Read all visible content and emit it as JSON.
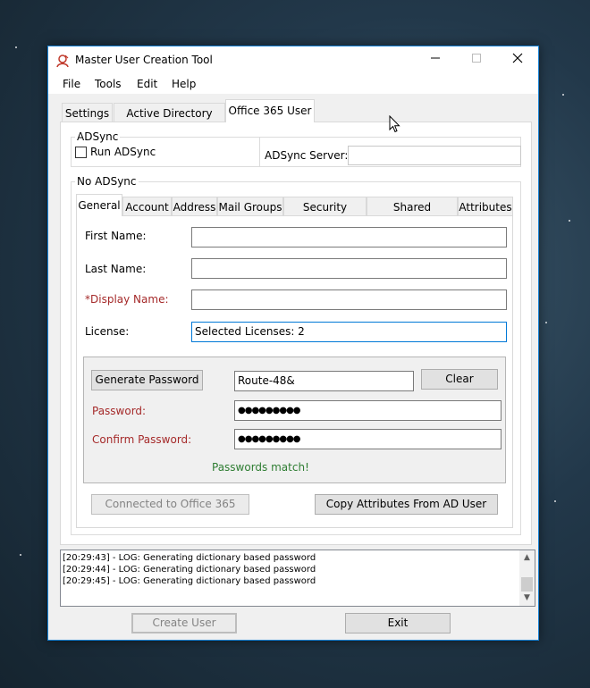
{
  "window": {
    "title": "Master User Creation Tool"
  },
  "menu": [
    "File",
    "Tools",
    "Edit",
    "Help"
  ],
  "main_tabs": [
    "Settings",
    "Active Directory User",
    "Office 365 User"
  ],
  "adsync": {
    "group_title": "ADSync",
    "run_label": "Run ADSync",
    "run_checked": false,
    "server_label": "ADSync Server:",
    "server_value": ""
  },
  "no_adsync": {
    "group_title": "No ADSync",
    "tabs": [
      "General",
      "Account",
      "Address",
      "Mail Groups",
      "Security Groups",
      "Shared Mailboxes",
      "Attributes"
    ]
  },
  "general": {
    "first_name_label": "First Name:",
    "first_name_value": "",
    "last_name_label": "Last Name:",
    "last_name_value": "",
    "display_name_label": "*Display Name:",
    "display_name_value": "",
    "license_label": "License:",
    "license_value": "Selected Licenses: 2"
  },
  "password": {
    "generate_label": "Generate Password",
    "generated_value": "Route-48&",
    "clear_label": "Clear",
    "password_label": "Password:",
    "password_value": "●●●●●●●●●",
    "confirm_label": "Confirm Password:",
    "confirm_value": "●●●●●●●●●",
    "match_status": "Passwords match!",
    "match_color": "#2e7d32"
  },
  "actions": {
    "connected_label": "Connected to Office 365",
    "copy_label": "Copy Attributes From AD User"
  },
  "log": [
    "[20:29:43] - LOG: Generating dictionary based password",
    "[20:29:44] - LOG: Generating dictionary based password",
    "[20:29:45] - LOG: Generating dictionary based password"
  ],
  "footer": {
    "create_label": "Create User",
    "exit_label": "Exit"
  },
  "colors": {
    "accent": "#1883d7",
    "required_label": "#a52a2a"
  }
}
